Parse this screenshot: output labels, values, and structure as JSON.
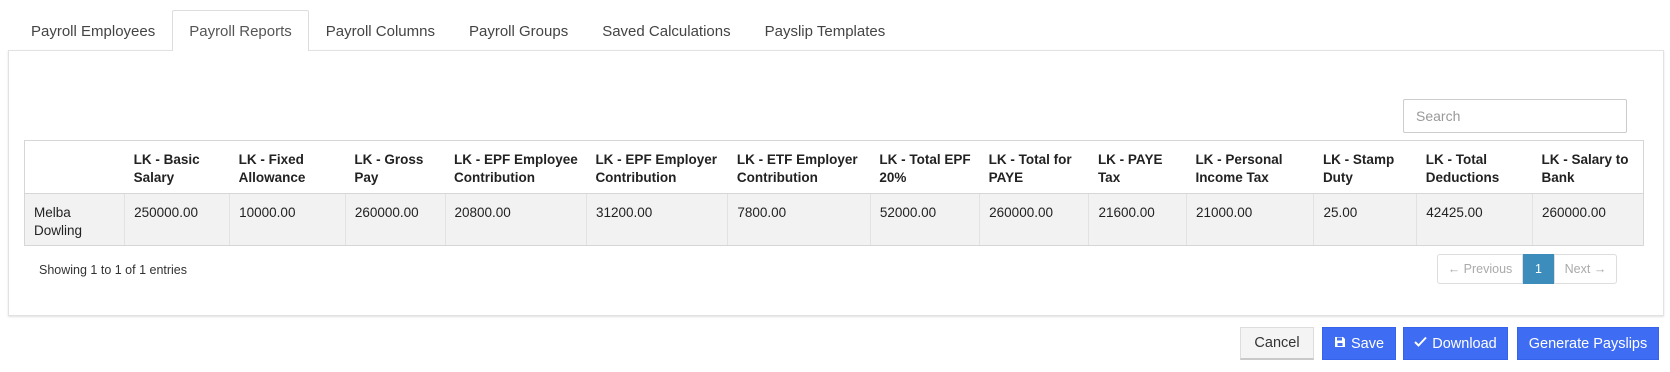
{
  "tabs": [
    {
      "label": "Payroll Employees"
    },
    {
      "label": "Payroll Reports"
    },
    {
      "label": "Payroll Columns"
    },
    {
      "label": "Payroll Groups"
    },
    {
      "label": "Saved Calculations"
    },
    {
      "label": "Payslip Templates"
    }
  ],
  "active_tab": "Payroll Reports",
  "search": {
    "placeholder": "Search",
    "value": ""
  },
  "table": {
    "columns": [
      {
        "label": ""
      },
      {
        "label": "LK - Basic Salary"
      },
      {
        "label": "LK - Fixed Allowance"
      },
      {
        "label": "LK - Gross Pay"
      },
      {
        "label": "LK - EPF Employee Contribution"
      },
      {
        "label": "LK - EPF Employer Contribution"
      },
      {
        "label": "LK - ETF Employer Contribution"
      },
      {
        "label": "LK - Total EPF 20%"
      },
      {
        "label": "LK - Total for PAYE"
      },
      {
        "label": "LK - PAYE Tax"
      },
      {
        "label": "LK - Personal Income Tax"
      },
      {
        "label": "LK - Stamp Duty"
      },
      {
        "label": "LK - Total Deductions"
      },
      {
        "label": "LK - Salary to Bank"
      }
    ],
    "rows": [
      [
        "Melba Dowling",
        "250000.00",
        "10000.00",
        "260000.00",
        "20800.00",
        "31200.00",
        "7800.00",
        "52000.00",
        "260000.00",
        "21600.00",
        "21000.00",
        "25.00",
        "42425.00",
        "260000.00"
      ]
    ]
  },
  "info_text": "Showing 1 to 1 of 1 entries",
  "pagination": {
    "previous": "← Previous",
    "current": "1",
    "next": "Next →"
  },
  "buttons": {
    "cancel": "Cancel",
    "save": "Save",
    "download": "Download",
    "generate": "Generate Payslips"
  },
  "icons": {
    "save": "floppy-disk-icon",
    "download": "check-icon"
  },
  "colors": {
    "primary": "#3e6cf2",
    "pager_active": "#3c8dbc"
  }
}
